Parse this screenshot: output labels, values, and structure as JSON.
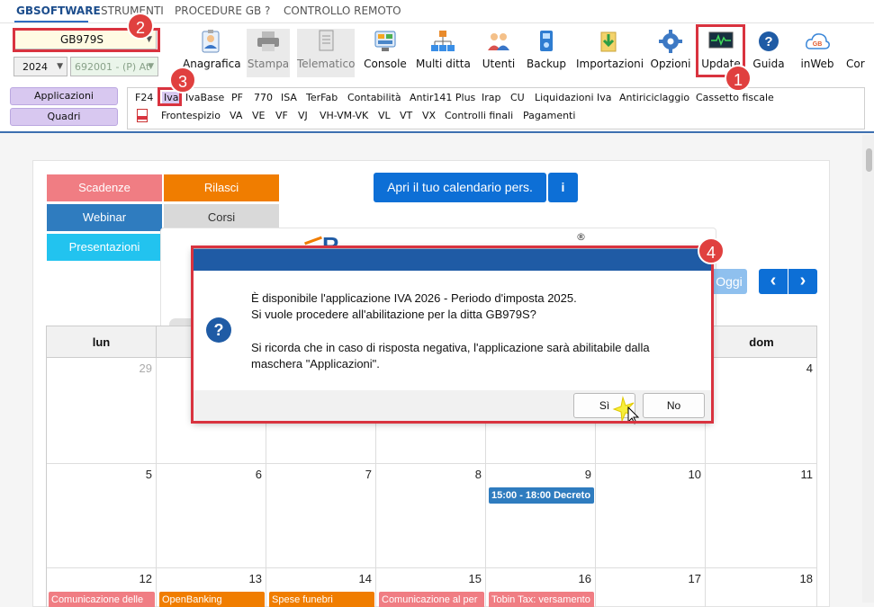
{
  "menu": {
    "items": [
      "GBSOFTWARE",
      "STRUMENTI",
      "PROCEDURE GB",
      "?",
      "CONTROLLO REMOTO"
    ]
  },
  "ribbon": {
    "company": "GB979S",
    "year": "2024",
    "activity": "692001 - (P) At",
    "tools": [
      "Anagrafica",
      "Stampa",
      "Telematico",
      "Console",
      "Multi ditta",
      "Utenti",
      "Backup",
      "Importazioni",
      "Opzioni",
      "Update",
      "Guida",
      "inWeb",
      "Cor"
    ]
  },
  "left_buttons": {
    "applicazioni": "Applicazioni",
    "quadri": "Quadri"
  },
  "app_tabs": [
    "F24",
    "Iva",
    "IvaBase",
    "PF",
    "770",
    "ISA",
    "TerFab",
    "Contabilità",
    "Antir141 Plus",
    "Irap",
    "CU",
    "Liquidazioni Iva",
    "Antiriciclaggio",
    "Cassetto fiscale"
  ],
  "quadri_tabs": [
    "Frontespizio",
    "VA",
    "VE",
    "VF",
    "VJ",
    "VH-VM-VK",
    "VL",
    "VT",
    "VX",
    "Controlli finali",
    "Pagamenti"
  ],
  "categories": {
    "scadenze": "Scadenze",
    "rilasci": "Rilasci",
    "webinar": "Webinar",
    "corsi": "Corsi",
    "presentazioni": "Presentazioni"
  },
  "calendar": {
    "open_button": "Apri il tuo calendario pers.",
    "info_button": "i",
    "today_button": "Oggi",
    "prev": "‹",
    "next": "›",
    "registered_mark": "®",
    "head_left": "lun",
    "head_right": "dom",
    "row1": [
      "29",
      "",
      "",
      "",
      "",
      "",
      "4"
    ],
    "row2": [
      "5",
      "6",
      "7",
      "8",
      "9",
      "10",
      "11"
    ],
    "row3": [
      "12",
      "13",
      "14",
      "15",
      "16",
      "17",
      "18"
    ],
    "event_row2": "15:00 - 18:00 Decreto",
    "events_row3": [
      "Comunicazione delle",
      "OpenBanking",
      "Spese funebri",
      "Comunicazione al per",
      "Tobin Tax: versamento"
    ]
  },
  "dialog": {
    "line1": "È disponibile l'applicazione IVA 2026 - Periodo d'imposta 2025.",
    "line2": "Si vuole procedere all'abilitazione per la ditta GB979S?",
    "line3": "Si ricorda che in caso di risposta negativa, l'applicazione sarà abilitabile dalla",
    "line4": "maschera \"Applicazioni\".",
    "icon": "?",
    "yes": "Sì",
    "no": "No"
  },
  "annotations": [
    "1",
    "2",
    "3",
    "4"
  ],
  "colors": {
    "scadenze": "#f07d83",
    "rilasci": "#f07d00",
    "webinar": "#2f7cbf",
    "corsi": "#d9d9d9",
    "presentazioni": "#22c3ef",
    "primary": "#0d6fd6",
    "dialog_title": "#1f5ba5",
    "annotation": "#e0403f"
  }
}
